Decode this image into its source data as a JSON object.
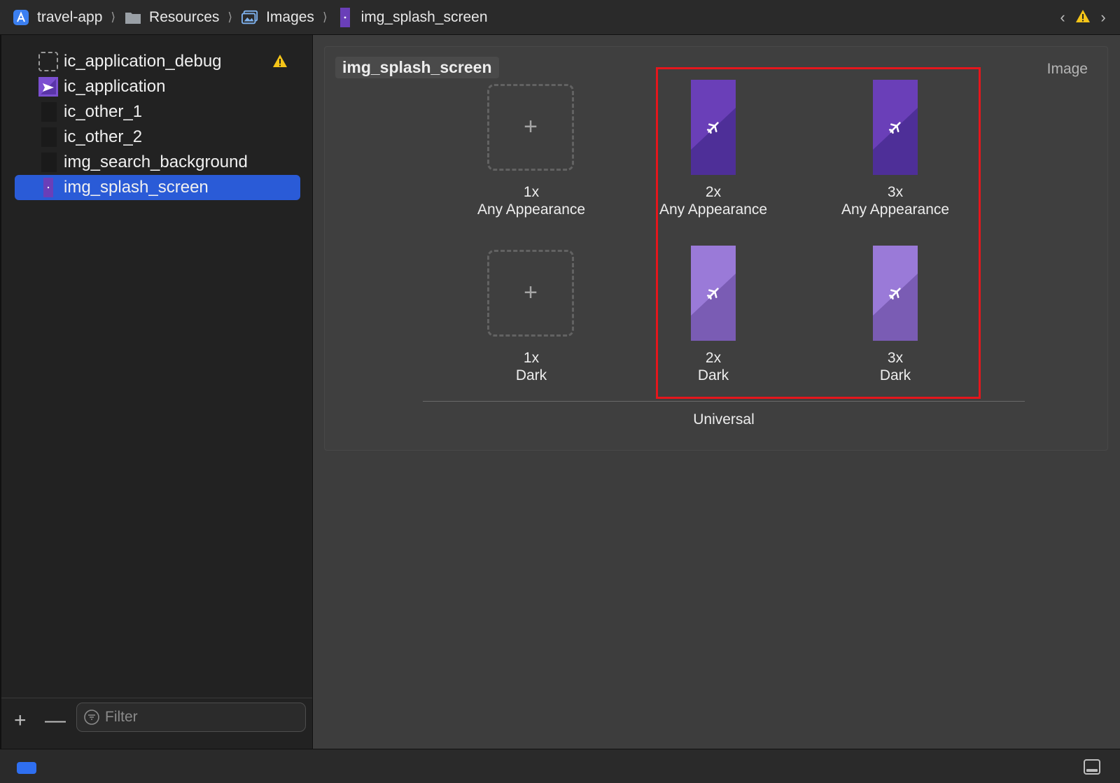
{
  "breadcrumb": [
    {
      "label": "travel-app",
      "icon": "xcode-project-icon"
    },
    {
      "label": "Resources",
      "icon": "folder-icon"
    },
    {
      "label": "Images",
      "icon": "image-folder-icon"
    },
    {
      "label": "img_splash_screen",
      "icon": "image-asset-icon"
    }
  ],
  "nav": {
    "back_icon": "chevron-left-icon",
    "warning_icon": "warning-icon",
    "forward_icon": "chevron-right-icon"
  },
  "sidebar": {
    "assets": [
      {
        "label": "ic_application_debug",
        "thumb": "empty",
        "warning": true,
        "selected": false
      },
      {
        "label": "ic_application",
        "thumb": "purple-plane",
        "warning": false,
        "selected": false
      },
      {
        "label": "ic_other_1",
        "thumb": "dark",
        "warning": false,
        "selected": false
      },
      {
        "label": "ic_other_2",
        "thumb": "dark",
        "warning": false,
        "selected": false
      },
      {
        "label": "img_search_background",
        "thumb": "dark",
        "warning": false,
        "selected": false
      },
      {
        "label": "img_splash_screen",
        "thumb": "purple-small",
        "warning": false,
        "selected": true
      }
    ],
    "add_icon": "plus-icon",
    "remove_icon": "minus-icon",
    "filter_icon": "filter-icon",
    "filter_placeholder": "Filter",
    "filter_value": ""
  },
  "editor": {
    "set_name": "img_splash_screen",
    "type_label": "Image",
    "group_label": "Universal",
    "slots": [
      {
        "scale": "1x",
        "appearance": "Any Appearance",
        "filled": false
      },
      {
        "scale": "2x",
        "appearance": "Any Appearance",
        "filled": true,
        "variant": "any"
      },
      {
        "scale": "3x",
        "appearance": "Any Appearance",
        "filled": true,
        "variant": "any"
      },
      {
        "scale": "1x",
        "appearance": "Dark",
        "filled": false
      },
      {
        "scale": "2x",
        "appearance": "Dark",
        "filled": true,
        "variant": "dark"
      },
      {
        "scale": "3x",
        "appearance": "Dark",
        "filled": true,
        "variant": "dark"
      }
    ]
  },
  "colors": {
    "selection": "#2a5bd7",
    "highlight": "#e5161c",
    "splash_any_top": "#6a3fb8",
    "splash_any_bottom": "#4e2f98",
    "splash_dark_top": "#9a7ad8",
    "splash_dark_bottom": "#7a5cb4",
    "warning": "#f5c518",
    "status_blue": "#2f6ff0"
  }
}
